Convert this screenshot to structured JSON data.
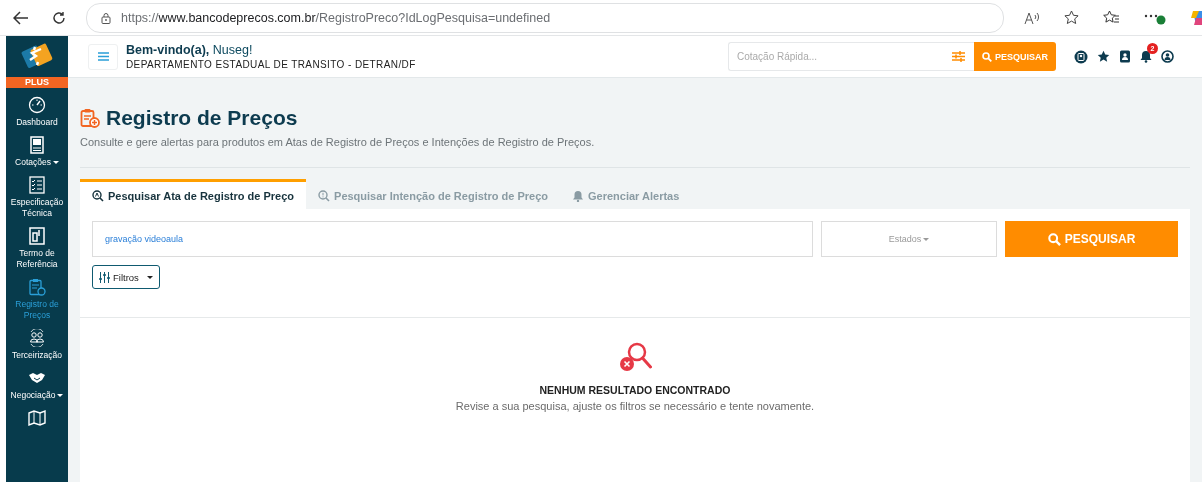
{
  "browser": {
    "url": "https://**www.bancodeprecos.com.br**/RegistroPreco?IdLogPesquisa=undefined"
  },
  "sidebar": {
    "badge": "PLUS",
    "items": [
      {
        "label": "Dashboard",
        "dropdown": false,
        "selected": false
      },
      {
        "label": "Cotações",
        "dropdown": true,
        "selected": false
      },
      {
        "label": "Especificação Técnica",
        "dropdown": false,
        "selected": false
      },
      {
        "label": "Termo de Referência",
        "dropdown": false,
        "selected": false
      },
      {
        "label": "Registro de Preços",
        "dropdown": false,
        "selected": true
      },
      {
        "label": "Terceirização",
        "dropdown": false,
        "selected": false
      },
      {
        "label": "Negociação",
        "dropdown": true,
        "selected": false
      },
      {
        "dropdown": false,
        "selected": false
      }
    ]
  },
  "header": {
    "greeting": "**Bem-vindo(a),** Nuseg!",
    "organization": "DEPARTAMENTO ESTADUAL DE TRANSITO - DETRAN/DF",
    "quick_search": {
      "placeholder": "Cotação Rápida...",
      "button": "PESQUISAR"
    },
    "notifications": "2"
  },
  "page": {
    "title": "Registro de Preços",
    "description": "Consulte e gere alertas para produtos em Atas de Registro de Preços e Intenções de Registro de Preços."
  },
  "tabs": [
    {
      "label": "Pesquisar Ata de Registro de Preço",
      "selected": true
    },
    {
      "label": "Pesquisar Intenção de Registro de Preço",
      "selected": false
    },
    {
      "label": "Gerenciar Alertas",
      "selected": false
    }
  ],
  "search": {
    "value": "gravação videoaula",
    "states_select": "Estados",
    "button": "PESQUISAR",
    "filters": "Filtros"
  },
  "empty_state": {
    "title": "NENHUM RESULTADO ENCONTRADO",
    "message": "Revise a sua pesquisa, ajuste os filtros se necessário e tente novamente."
  }
}
